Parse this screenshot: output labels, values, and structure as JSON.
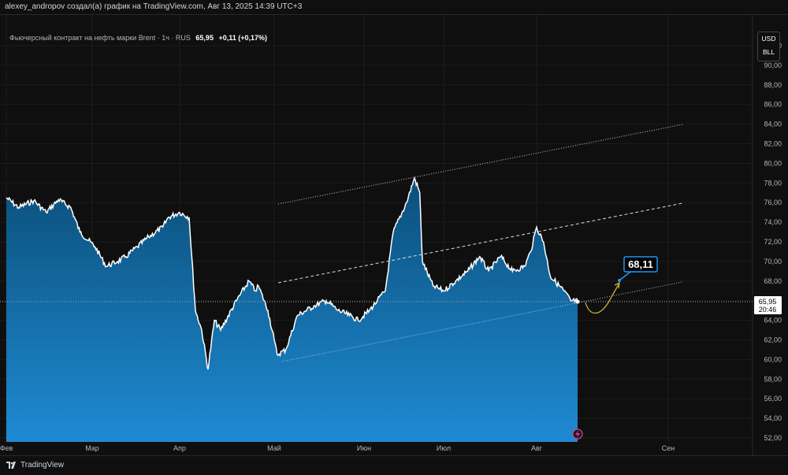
{
  "header": {
    "author_line": "alexey_andropov создал(а) график на TradingView.com, Авг 13, 2025 14:39 UTC+3"
  },
  "legend": {
    "symbol": "Фьючерсный контракт на нефть марки Brent · 1ч · RUS",
    "last": "65,95",
    "change": "+0,11 (+0,17%)"
  },
  "currency": {
    "top": "USD",
    "bottom": "BLL"
  },
  "price_label": {
    "price": "65,95",
    "countdown": "20:46"
  },
  "callout": {
    "text": "68,11",
    "color": "#2196f3"
  },
  "footer": {
    "brand": "TradingView"
  },
  "colors": {
    "area_top": "#0c5a8a",
    "area_bottom": "#1e88d0",
    "line": "#ffffff",
    "arrow": "#c9b22b",
    "background": "#0f0f0f"
  },
  "chart_data": {
    "type": "area",
    "title": "Фьючерсный контракт на нефть марки Brent",
    "ylim": [
      52,
      92
    ],
    "y_ticks": [
      "52,00",
      "54,00",
      "56,00",
      "58,00",
      "60,00",
      "62,00",
      "64,00",
      "66,00",
      "68,00",
      "70,00",
      "72,00",
      "74,00",
      "76,00",
      "78,00",
      "80,00",
      "82,00",
      "84,00",
      "86,00",
      "88,00",
      "90,00",
      "92,00"
    ],
    "x_ticks": [
      {
        "label": "Фев",
        "date": "2025-02-01"
      },
      {
        "label": "Мар",
        "date": "2025-03-01"
      },
      {
        "label": "Апр",
        "date": "2025-04-01"
      },
      {
        "label": "Май",
        "date": "2025-05-01"
      },
      {
        "label": "Июн",
        "date": "2025-06-01"
      },
      {
        "label": "Июл",
        "date": "2025-07-01"
      },
      {
        "label": "Авг",
        "date": "2025-08-01"
      },
      {
        "label": "Сен",
        "date": "2025-09-01"
      }
    ],
    "points": [
      [
        "2025-02-01",
        76.5
      ],
      [
        "2025-02-05",
        75.5
      ],
      [
        "2025-02-10",
        76.2
      ],
      [
        "2025-02-14",
        75
      ],
      [
        "2025-02-18",
        76.3
      ],
      [
        "2025-02-22",
        75.5
      ],
      [
        "2025-02-25",
        73
      ],
      [
        "2025-03-02",
        71.5
      ],
      [
        "2025-03-06",
        69.5
      ],
      [
        "2025-03-10",
        70
      ],
      [
        "2025-03-13",
        70.5
      ],
      [
        "2025-03-17",
        71.5
      ],
      [
        "2025-03-21",
        72.5
      ],
      [
        "2025-03-26",
        73.5
      ],
      [
        "2025-03-28",
        74.5
      ],
      [
        "2025-04-01",
        75
      ],
      [
        "2025-04-04",
        74.5
      ],
      [
        "2025-04-06",
        65
      ],
      [
        "2025-04-08",
        63
      ],
      [
        "2025-04-10",
        59
      ],
      [
        "2025-04-12",
        64
      ],
      [
        "2025-04-14",
        63
      ],
      [
        "2025-04-19",
        66
      ],
      [
        "2025-04-23",
        68
      ],
      [
        "2025-04-25",
        67
      ],
      [
        "2025-04-26",
        67.5
      ],
      [
        "2025-04-29",
        65
      ],
      [
        "2025-05-01",
        62
      ],
      [
        "2025-05-02",
        60.5
      ],
      [
        "2025-05-05",
        61
      ],
      [
        "2025-05-09",
        64.5
      ],
      [
        "2025-05-15",
        65.5
      ],
      [
        "2025-05-19",
        66
      ],
      [
        "2025-05-23",
        65
      ],
      [
        "2025-05-27",
        64.5
      ],
      [
        "2025-05-30",
        64
      ],
      [
        "2025-06-03",
        65
      ],
      [
        "2025-06-06",
        66
      ],
      [
        "2025-06-09",
        67
      ],
      [
        "2025-06-12",
        73
      ],
      [
        "2025-06-17",
        76
      ],
      [
        "2025-06-20",
        78.5
      ],
      [
        "2025-06-22",
        77
      ],
      [
        "2025-06-23",
        70
      ],
      [
        "2025-06-27",
        67.5
      ],
      [
        "2025-07-01",
        67
      ],
      [
        "2025-07-05",
        68
      ],
      [
        "2025-07-09",
        69
      ],
      [
        "2025-07-13",
        70.5
      ],
      [
        "2025-07-16",
        69
      ],
      [
        "2025-07-20",
        70.5
      ],
      [
        "2025-07-24",
        69
      ],
      [
        "2025-07-28",
        69.5
      ],
      [
        "2025-07-30",
        71
      ],
      [
        "2025-08-01",
        73.5
      ],
      [
        "2025-08-03",
        72
      ],
      [
        "2025-08-05",
        68.5
      ],
      [
        "2025-08-09",
        67
      ],
      [
        "2025-08-11",
        66
      ],
      [
        "2025-08-13",
        65.95
      ]
    ],
    "last_price": 65.95,
    "target_price": 68.11,
    "grid": true
  }
}
